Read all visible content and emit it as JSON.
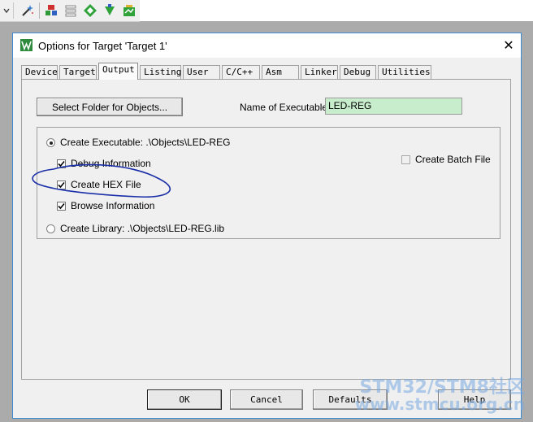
{
  "toolbar": {
    "icons": [
      "dropdown-arrow-icon",
      "magic-wand-icon",
      "target-options-icon",
      "manage-project-icon",
      "select-packs-icon",
      "pack-installer-icon",
      "batch-setup-icon"
    ]
  },
  "dialog": {
    "title": "Options for Target 'Target 1'",
    "close_glyph": "✕"
  },
  "tabs": [
    "Device",
    "Target",
    "Output",
    "Listing",
    "User",
    "C/C++",
    "Asm",
    "Linker",
    "Debug",
    "Utilities"
  ],
  "active_tab": "Output",
  "output": {
    "select_folder_label": "Select Folder for Objects...",
    "name_label": "Name of Executable:",
    "name_value": "LED-REG",
    "create_executable_label": "Create Executable:  .\\Objects\\LED-REG",
    "create_executable_selected": true,
    "debug_info_label": "Debug Information",
    "debug_info_checked": true,
    "create_hex_label": "Create HEX File",
    "create_hex_checked": true,
    "browse_info_label": "Browse Information",
    "browse_info_checked": true,
    "create_batch_label": "Create Batch File",
    "create_batch_checked": false,
    "create_library_label": "Create Library:  .\\Objects\\LED-REG.lib",
    "create_library_selected": false
  },
  "buttons": {
    "ok": "OK",
    "cancel": "Cancel",
    "defaults": "Defaults",
    "help": "Help"
  },
  "watermark": {
    "line1": "STM32/STM8社区",
    "line2": "www.stmcu.org.cn"
  },
  "colors": {
    "name_field_bg": "#c7edcc",
    "annotation_ink": "#1a2fa8"
  }
}
